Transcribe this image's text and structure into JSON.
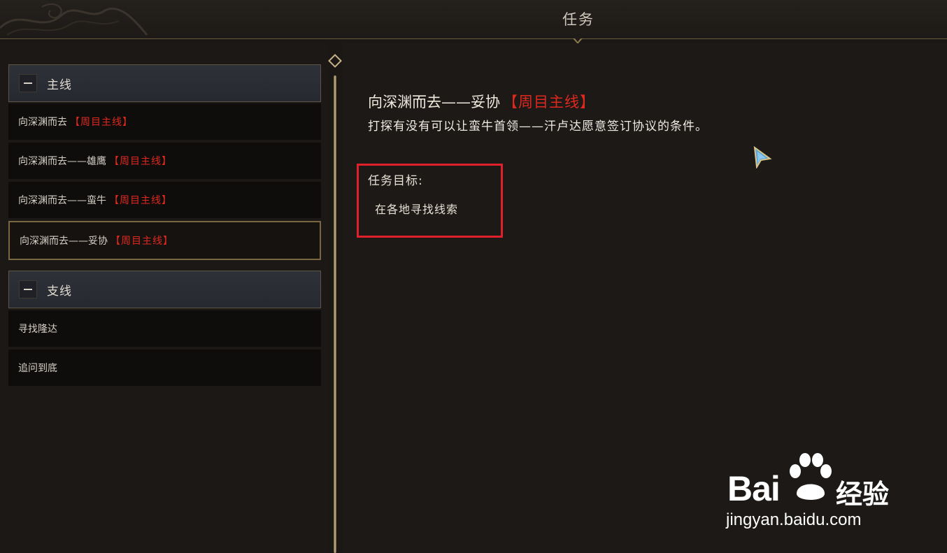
{
  "header": {
    "title": "任务"
  },
  "left_panel": {
    "groups": [
      {
        "label": "主线",
        "items": [
          {
            "name": "向深渊而去",
            "tag": "【周目主线】",
            "selected": false
          },
          {
            "name": "向深渊而去——雄鹰",
            "tag": "【周目主线】",
            "selected": false
          },
          {
            "name": "向深渊而去——蛮牛",
            "tag": "【周目主线】",
            "selected": false
          },
          {
            "name": "向深渊而去——妥协",
            "tag": "【周目主线】",
            "selected": true
          }
        ]
      },
      {
        "label": "支线",
        "items": [
          {
            "name": "寻找隆达",
            "tag": "",
            "selected": false
          },
          {
            "name": "追问到底",
            "tag": "",
            "selected": false
          }
        ]
      }
    ]
  },
  "detail": {
    "title": "向深渊而去——妥协",
    "title_tag": "【周目主线】",
    "description": "打探有没有可以让蛮牛首领——汗卢达愿意签订协议的条件。",
    "objective_label": "任务目标:",
    "objective_item": "在各地寻找线索"
  },
  "watermark": {
    "brand": "Bai",
    "brand_du": "du",
    "product": "经验",
    "url": "jingyan.baidu.com"
  },
  "colors": {
    "tag_red": "#e0281e",
    "highlight_box": "#e0202a",
    "gold_border": "#7a6640",
    "background": "#1a1715"
  }
}
